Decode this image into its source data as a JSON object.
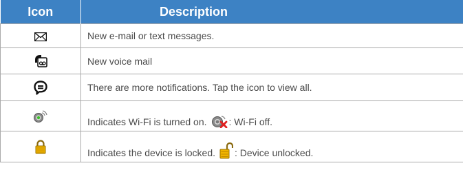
{
  "header": {
    "icon_label": "Icon",
    "description_label": "Description"
  },
  "rows": [
    {
      "icon": "envelope-icon",
      "description": "New e-mail or text messages."
    },
    {
      "icon": "voicemail-icon",
      "description": "New voice mail"
    },
    {
      "icon": "speech-bubble-icon",
      "description": "There are more notifications. Tap the icon to view all."
    },
    {
      "icon": "wifi-on-icon",
      "description": "Indicates Wi-Fi is turned on.",
      "inline_icon": "wifi-off-icon",
      "description_suffix": ": Wi-Fi off."
    },
    {
      "icon": "lock-icon",
      "description": "Indicates the device is locked.",
      "inline_icon": "unlock-icon",
      "description_suffix": ": Device unlocked."
    }
  ],
  "colors": {
    "header_bg": "#3d82c4",
    "header_text": "#ffffff",
    "body_text": "#4a4a4a",
    "border": "#a9a9a9"
  }
}
